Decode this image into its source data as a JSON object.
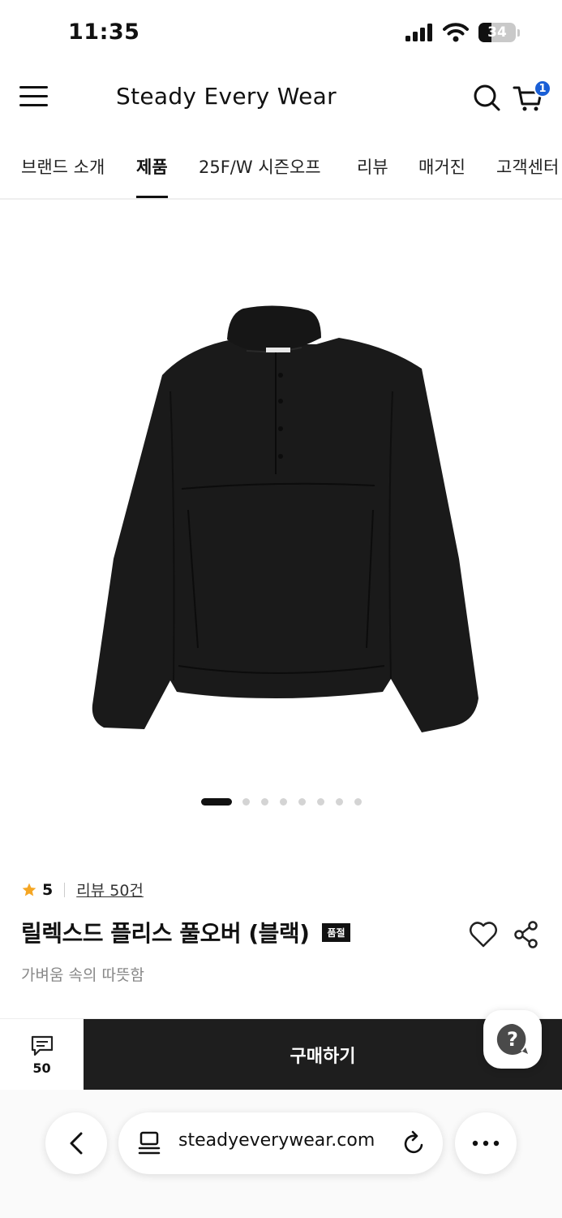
{
  "status_bar": {
    "time": "11:35",
    "battery": "34"
  },
  "header": {
    "brand": "Steady Every Wear",
    "cart_count": "1"
  },
  "nav": {
    "tabs": [
      {
        "label": "브랜드 소개",
        "active": false
      },
      {
        "label": "제품",
        "active": true
      },
      {
        "label": "25F/W 시즌오프",
        "active": false
      },
      {
        "label": "리뷰",
        "active": false
      },
      {
        "label": "매거진",
        "active": false
      },
      {
        "label": "고객센터",
        "active": false
      }
    ]
  },
  "gallery": {
    "slide_count": 8,
    "active_slide": 1
  },
  "product": {
    "rating": "5",
    "reviews_link": "리뷰 50건",
    "title": "릴렉스드 플리스 풀오버 (블랙)",
    "badge": "품절",
    "subtitle": "가벼움 속의 따뜻함"
  },
  "purchase_bar": {
    "review_count": "50",
    "buy_label": "구매하기"
  },
  "browser": {
    "url": "steadyeverywear.com"
  }
}
